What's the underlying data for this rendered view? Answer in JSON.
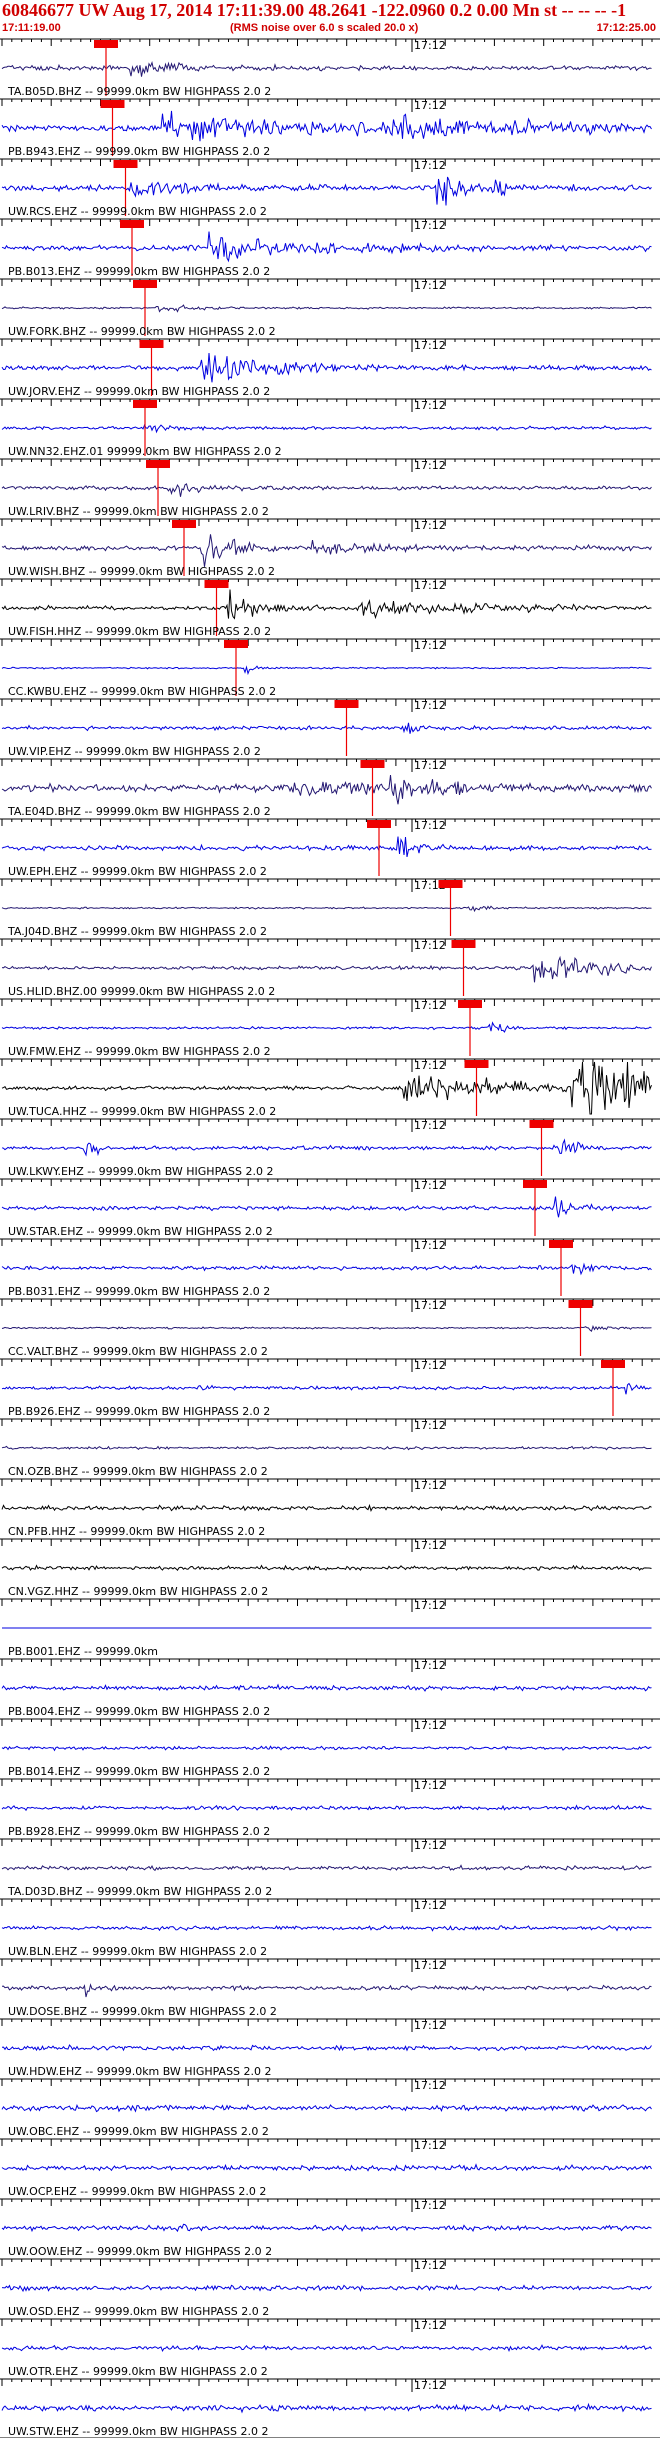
{
  "header": {
    "title": "60846677 UW Aug 17, 2014 17:11:39.00   48.2641 -122.0960  0.2 0.00 Mn st -- -- --  -1",
    "start_time": "17:11:19.00",
    "note": "(RMS noise over 6.0 s scaled 20.0 x)",
    "end_time": "17:12:25.00",
    "minute_label": "17:12"
  },
  "colors": {
    "blue": "#0000e0",
    "navy": "#241872",
    "black": "#000000",
    "pick": "#ee0000"
  },
  "traces": [
    {
      "label": "TA.B05D.BHZ -- 99999.0km BW  HIGHPASS  2.0  2",
      "color": "navy",
      "noise": 0.14,
      "pick": 0.16,
      "bursts": [
        {
          "pos": 0.2,
          "amp": 0.55,
          "width": 0.05
        }
      ]
    },
    {
      "label": "PB.B943.EHZ -- 99999.0km BW  HIGHPASS  2.0  2",
      "color": "blue",
      "noise": 0.22,
      "pick": 0.17,
      "bursts": [
        {
          "pos": 0.25,
          "amp": 0.9,
          "width": 0.18
        },
        {
          "pos": 0.6,
          "amp": 0.5,
          "width": 0.2
        }
      ]
    },
    {
      "label": "UW.RCS.EHZ -- 99999.0km BW  HIGHPASS  2.0  2",
      "color": "blue",
      "noise": 0.18,
      "pick": 0.19,
      "bursts": [
        {
          "pos": 0.2,
          "amp": 0.8,
          "width": 0.07
        },
        {
          "pos": 0.67,
          "amp": 1.0,
          "width": 0.03
        },
        {
          "pos": 0.76,
          "amp": 0.5,
          "width": 0.02
        }
      ]
    },
    {
      "label": "PB.B013.EHZ -- 99999.0km BW  HIGHPASS  2.0  2",
      "color": "blue",
      "noise": 0.16,
      "pick": 0.2,
      "bursts": [
        {
          "pos": 0.32,
          "amp": 1.0,
          "width": 0.13
        }
      ]
    },
    {
      "label": "UW.FORK.BHZ -- 99999.0km BW  HIGHPASS  2.0  2",
      "color": "navy",
      "noise": 0.06,
      "pick": 0.22,
      "bursts": [
        {
          "pos": 0.24,
          "amp": 0.25,
          "width": 0.05
        }
      ]
    },
    {
      "label": "UW.JORV.EHZ -- 99999.0km BW  HIGHPASS  2.0  2",
      "color": "blue",
      "noise": 0.15,
      "pick": 0.23,
      "bursts": [
        {
          "pos": 0.31,
          "amp": 1.15,
          "width": 0.1
        }
      ]
    },
    {
      "label": "UW.NN32.EHZ.01 99999.0km BW  HIGHPASS  2.0  2",
      "color": "blue",
      "noise": 0.1,
      "pick": 0.22,
      "bursts": [
        {
          "pos": 0.22,
          "amp": 0.35,
          "width": 0.03
        }
      ]
    },
    {
      "label": "UW.LRIV.BHZ -- 99999.0km BW  HIGHPASS  2.0  2",
      "color": "navy",
      "noise": 0.12,
      "pick": 0.24,
      "bursts": [
        {
          "pos": 0.26,
          "amp": 0.6,
          "width": 0.03
        }
      ]
    },
    {
      "label": "UW.WISH.BHZ -- 99999.0km BW  HIGHPASS  2.0  2",
      "color": "navy",
      "noise": 0.14,
      "pick": 0.28,
      "bursts": [
        {
          "pos": 0.31,
          "amp": 1.2,
          "width": 0.04
        },
        {
          "pos": 0.48,
          "amp": 0.4,
          "width": 0.08
        }
      ]
    },
    {
      "label": "UW.FISH.HHZ -- 99999.0km BW  HIGHPASS  2.0  2",
      "color": "black",
      "noise": 0.12,
      "pick": 0.33,
      "bursts": [
        {
          "pos": 0.35,
          "amp": 1.1,
          "width": 0.04
        },
        {
          "pos": 0.55,
          "amp": 0.55,
          "width": 0.16
        }
      ]
    },
    {
      "label": "CC.KWBU.EHZ -- 99999.0km BW  HIGHPASS  2.0  2",
      "color": "blue",
      "noise": 0.05,
      "pick": 0.36,
      "bursts": [
        {
          "pos": 0.375,
          "amp": 0.45,
          "width": 0.01
        }
      ]
    },
    {
      "label": "UW.VIP.EHZ -- 99999.0km BW  HIGHPASS  2.0  2",
      "color": "blue",
      "noise": 0.12,
      "pick": 0.53,
      "bursts": [
        {
          "pos": 0.62,
          "amp": 0.55,
          "width": 0.02
        }
      ]
    },
    {
      "label": "TA.E04D.BHZ -- 99999.0km BW  HIGHPASS  2.0  2",
      "color": "navy",
      "noise": 0.22,
      "pick": 0.57,
      "bursts": [
        {
          "pos": 0.6,
          "amp": 1.1,
          "width": 0.03
        },
        {
          "pos": 0.45,
          "amp": 0.45,
          "width": 0.2
        }
      ]
    },
    {
      "label": "UW.EPH.EHZ -- 99999.0km BW  HIGHPASS  2.0  2",
      "color": "blue",
      "noise": 0.15,
      "pick": 0.58,
      "bursts": [
        {
          "pos": 0.61,
          "amp": 0.75,
          "width": 0.02
        }
      ]
    },
    {
      "label": "TA.J04D.BHZ -- 99999.0km BW  HIGHPASS  2.0  2",
      "color": "navy",
      "noise": 0.05,
      "pick": 0.69,
      "bursts": [
        {
          "pos": 0.72,
          "amp": 0.2,
          "width": 0.04
        }
      ]
    },
    {
      "label": "US.HLID.BHZ.00 99999.0km BW  HIGHPASS  2.0  2",
      "color": "navy",
      "noise": 0.1,
      "pick": 0.71,
      "bursts": [
        {
          "pos": 0.82,
          "amp": 0.9,
          "width": 0.12
        }
      ]
    },
    {
      "label": "UW.FMW.EHZ -- 99999.0km BW  HIGHPASS  2.0  2",
      "color": "blue",
      "noise": 0.08,
      "pick": 0.72,
      "bursts": [
        {
          "pos": 0.75,
          "amp": 0.5,
          "width": 0.02
        }
      ]
    },
    {
      "label": "UW.TUCA.HHZ -- 99999.0km BW  HIGHPASS  2.0  2",
      "color": "black",
      "noise": 0.12,
      "pick": 0.73,
      "bursts": [
        {
          "pos": 0.62,
          "amp": 1.0,
          "width": 0.14
        },
        {
          "pos": 0.88,
          "amp": 1.9,
          "width": 0.2
        }
      ]
    },
    {
      "label": "UW.LKWY.EHZ -- 99999.0km BW  HIGHPASS  2.0  2",
      "color": "blue",
      "noise": 0.12,
      "pick": 0.83,
      "bursts": [
        {
          "pos": 0.13,
          "amp": 0.6,
          "width": 0.02
        },
        {
          "pos": 0.86,
          "amp": 0.9,
          "width": 0.015
        }
      ]
    },
    {
      "label": "UW.STAR.EHZ -- 99999.0km BW  HIGHPASS  2.0  2",
      "color": "blue",
      "noise": 0.12,
      "pick": 0.82,
      "bursts": [
        {
          "pos": 0.85,
          "amp": 1.0,
          "width": 0.02
        }
      ]
    },
    {
      "label": "PB.B031.EHZ -- 99999.0km BW  HIGHPASS  2.0  2",
      "color": "blue",
      "noise": 0.12,
      "pick": 0.86,
      "bursts": [
        {
          "pos": 0.88,
          "amp": 0.45,
          "width": 0.02
        }
      ]
    },
    {
      "label": "CC.VALT.BHZ -- 99999.0km BW  HIGHPASS  2.0  2",
      "color": "navy",
      "noise": 0.06,
      "pick": 0.89,
      "bursts": [
        {
          "pos": 0.9,
          "amp": 0.35,
          "width": 0.015
        }
      ]
    },
    {
      "label": "PB.B926.EHZ -- 99999.0km BW  HIGHPASS  2.0  2",
      "color": "blue",
      "noise": 0.1,
      "pick": 0.94,
      "bursts": [
        {
          "pos": 0.3,
          "amp": 0.5,
          "width": 0.01
        },
        {
          "pos": 0.96,
          "amp": 0.9,
          "width": 0.01
        }
      ]
    },
    {
      "label": "CN.OZB.BHZ -- 99999.0km BW  HIGHPASS  2.0  2",
      "color": "navy",
      "noise": 0.08,
      "pick": null,
      "bursts": []
    },
    {
      "label": "CN.PFB.HHZ -- 99999.0km BW  HIGHPASS  2.0  2",
      "color": "black",
      "noise": 0.14,
      "pick": null,
      "bursts": []
    },
    {
      "label": "CN.VGZ.HHZ -- 99999.0km BW  HIGHPASS  2.0  2",
      "color": "black",
      "noise": 0.12,
      "pick": null,
      "bursts": []
    },
    {
      "label": "PB.B001.EHZ -- 99999.0km",
      "color": "blue",
      "noise": 0.0,
      "pick": null,
      "bursts": []
    },
    {
      "label": "PB.B004.EHZ -- 99999.0km BW  HIGHPASS  2.0  2",
      "color": "blue",
      "noise": 0.14,
      "pick": null,
      "bursts": []
    },
    {
      "label": "PB.B014.EHZ -- 99999.0km BW  HIGHPASS  2.0  2",
      "color": "blue",
      "noise": 0.1,
      "pick": null,
      "bursts": []
    },
    {
      "label": "PB.B928.EHZ -- 99999.0km BW  HIGHPASS  2.0  2",
      "color": "blue",
      "noise": 0.12,
      "pick": null,
      "bursts": []
    },
    {
      "label": "TA.D03D.BHZ -- 99999.0km BW  HIGHPASS  2.0  2",
      "color": "navy",
      "noise": 0.12,
      "pick": null,
      "bursts": []
    },
    {
      "label": "UW.BLN.EHZ -- 99999.0km BW  HIGHPASS  2.0  2",
      "color": "blue",
      "noise": 0.12,
      "pick": null,
      "bursts": []
    },
    {
      "label": "UW.DOSE.BHZ -- 99999.0km BW  HIGHPASS  2.0  2",
      "color": "navy",
      "noise": 0.12,
      "pick": null,
      "bursts": [
        {
          "pos": 0.13,
          "amp": 0.35,
          "width": 0.02
        }
      ]
    },
    {
      "label": "UW.HDW.EHZ -- 99999.0km BW  HIGHPASS  2.0  2",
      "color": "blue",
      "noise": 0.14,
      "pick": null,
      "bursts": []
    },
    {
      "label": "UW.OBC.EHZ -- 99999.0km BW  HIGHPASS  2.0  2",
      "color": "blue",
      "noise": 0.16,
      "pick": null,
      "bursts": [
        {
          "pos": 0.19,
          "amp": 0.4,
          "width": 0.01
        }
      ]
    },
    {
      "label": "UW.OCP.EHZ -- 99999.0km BW  HIGHPASS  2.0  2",
      "color": "blue",
      "noise": 0.16,
      "pick": null,
      "bursts": []
    },
    {
      "label": "UW.OOW.EHZ -- 99999.0km BW  HIGHPASS  2.0  2",
      "color": "blue",
      "noise": 0.14,
      "pick": null,
      "bursts": [
        {
          "pos": 0.27,
          "amp": 0.7,
          "width": 0.01
        }
      ]
    },
    {
      "label": "UW.OSD.EHZ -- 99999.0km BW  HIGHPASS  2.0  2",
      "color": "blue",
      "noise": 0.14,
      "pick": null,
      "bursts": []
    },
    {
      "label": "UW.OTR.EHZ -- 99999.0km BW  HIGHPASS  2.0  2",
      "color": "blue",
      "noise": 0.14,
      "pick": null,
      "bursts": []
    },
    {
      "label": "UW.STW.EHZ -- 99999.0km BW  HIGHPASS  2.0  2",
      "color": "blue",
      "noise": 0.18,
      "pick": null,
      "bursts": []
    }
  ]
}
